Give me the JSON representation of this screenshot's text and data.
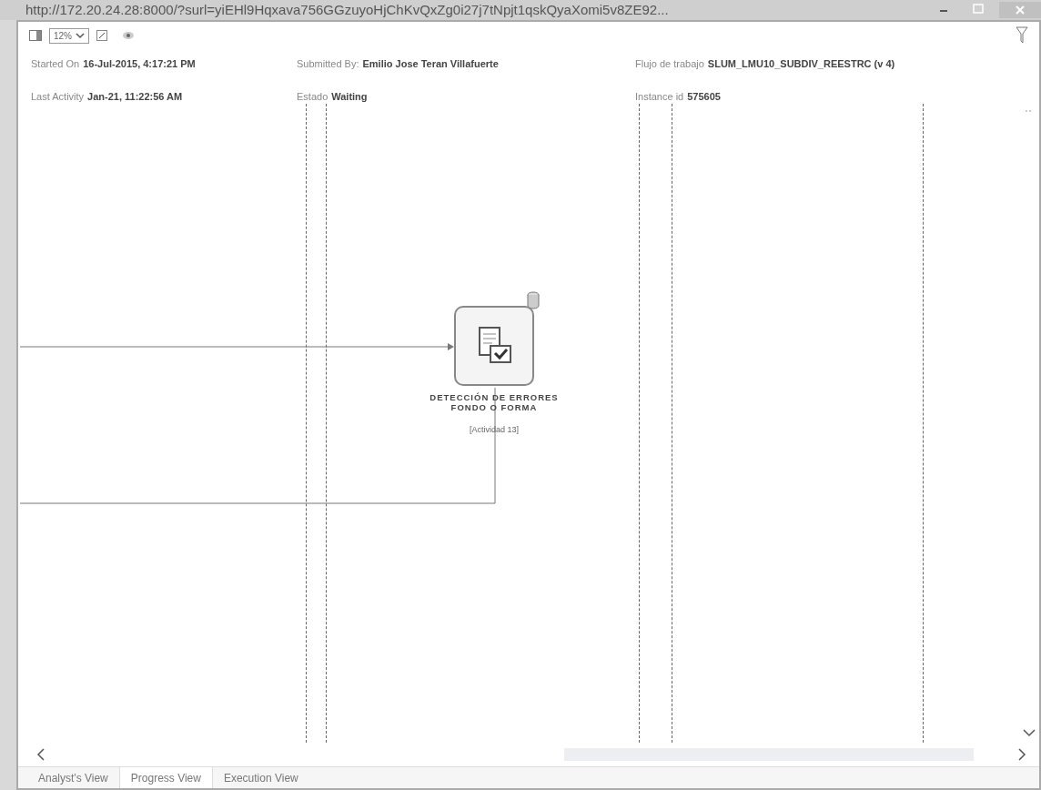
{
  "window": {
    "title": "http://172.20.24.28:8000/?surl=yiEHl9Hqxava756GGzuyoHjChKvQxZg0i27j7tNpjt1qskQyaXomi5v8ZE92..."
  },
  "toolbar": {
    "zoom": "12%"
  },
  "header": [
    {
      "label": "Started On",
      "value": "16-Jul-2015, 4:17:21 PM"
    },
    {
      "label": "Submitted By:",
      "value": "Emilio Jose Teran Villafuerte"
    },
    {
      "label": "Flujo de trabajo",
      "value": "SLUM_LMU10_SUBDIV_REESTRC (v 4)"
    },
    {
      "label": "Last Activity",
      "value": "Jan-21, 11:22:56 AM"
    },
    {
      "label": "Estado",
      "value": "Waiting"
    },
    {
      "label": "Instance id",
      "value": "575605"
    }
  ],
  "node": {
    "title": "DETECCIÓN DE ERRORES FONDO O FORMA",
    "subtitle": "[Actividad 13]"
  },
  "tabs": [
    {
      "label": "Analyst's View",
      "selected": false
    },
    {
      "label": "Progress View",
      "selected": true
    },
    {
      "label": "Execution View",
      "selected": false
    }
  ]
}
